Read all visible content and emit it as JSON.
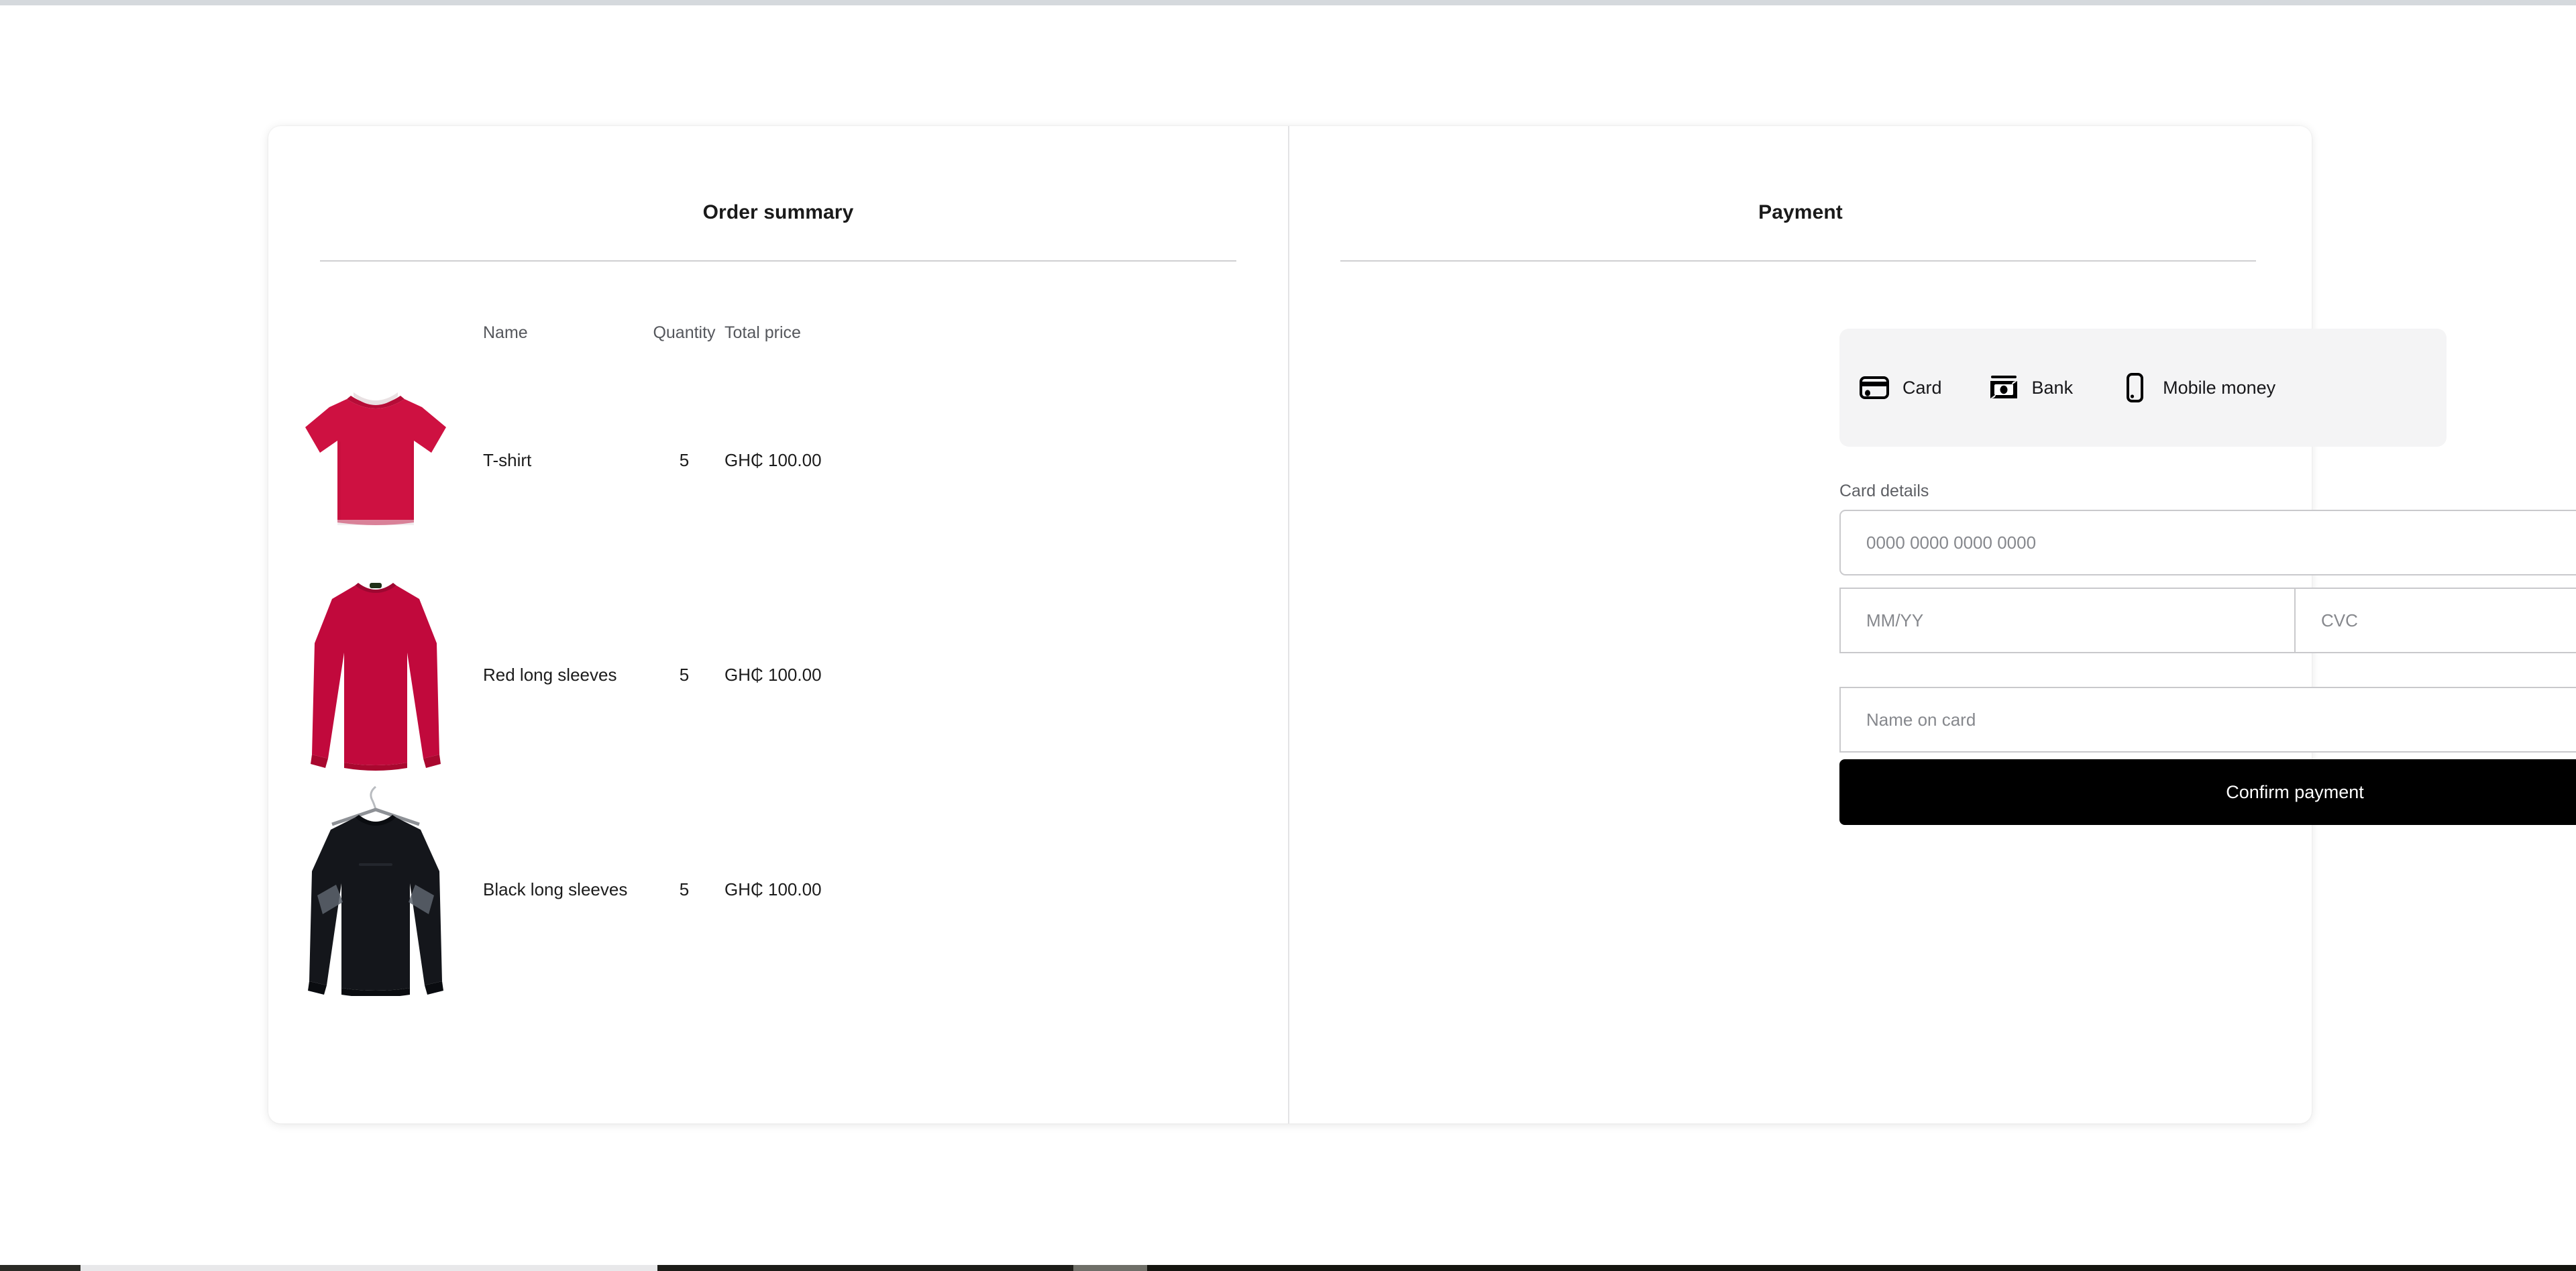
{
  "order": {
    "title": "Order summary",
    "columns": [
      "Name",
      "Quantity",
      "Total price"
    ],
    "items": [
      {
        "name": "T-shirt",
        "quantity": "5",
        "total_price": "GH₵ 100.00",
        "thumb": "red-tshirt-thumbnail"
      },
      {
        "name": "Red long sleeves",
        "quantity": "5",
        "total_price": "GH₵ 100.00",
        "thumb": "red-long-sleeve-thumbnail"
      },
      {
        "name": "Black long sleeves",
        "quantity": "5",
        "total_price": "GH₵ 100.00",
        "thumb": "black-long-sleeve-thumbnail"
      }
    ]
  },
  "payment": {
    "title": "Payment",
    "methods": [
      {
        "label": "Card",
        "icon": "credit-card-icon"
      },
      {
        "label": "Bank",
        "icon": "banknote-icon"
      },
      {
        "label": "Mobile money",
        "icon": "mobile-phone-icon"
      }
    ],
    "card_details_label": "Card details",
    "fields": {
      "card_number": {
        "value": "",
        "placeholder": "0000 0000 0000 0000"
      },
      "expiry": {
        "value": "",
        "placeholder": "MM/YY"
      },
      "cvc": {
        "value": "",
        "placeholder": "CVC"
      },
      "name_on_card": {
        "value": "",
        "placeholder": "Name on card"
      }
    },
    "confirm_label": "Confirm payment"
  },
  "colors": {
    "accent_red": "#CE1141",
    "button": "#000000",
    "pill_background": "#F4F4F5",
    "border": "#C9C9CC",
    "muted_text": "#5D5F64"
  }
}
